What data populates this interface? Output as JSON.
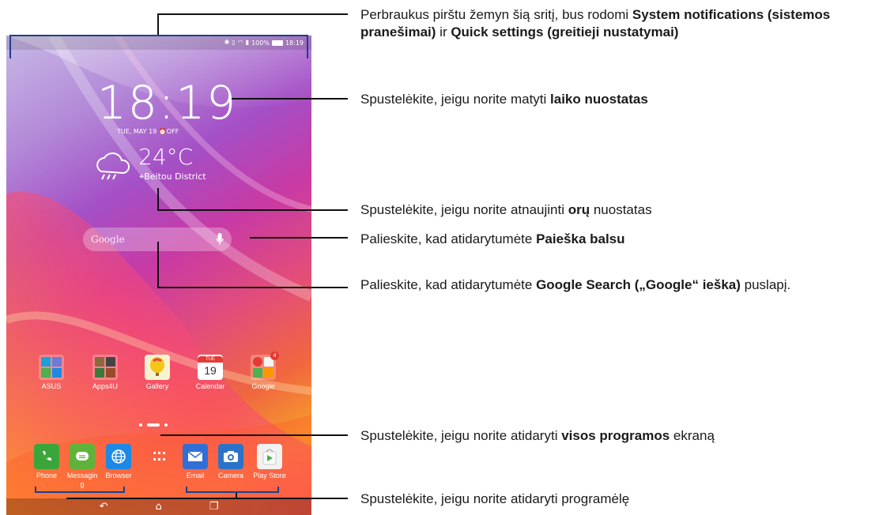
{
  "status_bar": {
    "battery": "100%",
    "time": "18:19"
  },
  "clock": {
    "time": "18:19",
    "date": "TUE, MAY 19",
    "alarm": "OFF"
  },
  "weather": {
    "temperature": "24°C",
    "location": "Beitou District"
  },
  "search": {
    "label": "Google"
  },
  "home_apps": [
    {
      "label": "ASUS"
    },
    {
      "label": "Apps4U"
    },
    {
      "label": "Gallery"
    },
    {
      "label": "Calendar",
      "day": "19",
      "weekday": "TUE"
    },
    {
      "label": "Google",
      "badge": "4"
    }
  ],
  "dock_apps": [
    {
      "label": "Phone"
    },
    {
      "label": "Messagin\ng"
    },
    {
      "label": "Browser"
    },
    {
      "label": "Email"
    },
    {
      "label": "Camera"
    },
    {
      "label": "Play Store"
    }
  ],
  "annotations": {
    "a1_pre": "Perbraukus pirštu žemyn šią sritį, bus rodomi ",
    "a1_b1": "System notifications (sistemos pranešimai)",
    "a1_mid": " ir ",
    "a1_b2": "Quick settings (greitieji nustatymai)",
    "a2_pre": "Spustelėkite, jeigu norite matyti ",
    "a2_b": "laiko nuostatas",
    "a3_pre": "Spustelėkite, jeigu norite atnaujinti ",
    "a3_b": "orų",
    "a3_post": " nuostatas",
    "a4_pre": "Palieskite, kad atidarytumėte ",
    "a4_b": "Paieška balsu",
    "a5_pre": "Palieskite, kad atidarytumėte ",
    "a5_b": "Google Search („Google“ ieška)",
    "a5_post": " puslapį.",
    "a6_pre": "Spustelėkite, jeigu norite atidaryti ",
    "a6_b": "visos programos",
    "a6_post": " ekraną",
    "a7": "Spustelėkite, jeigu norite atidaryti programėlę"
  },
  "colors": {
    "bracket": "#1e3f8c",
    "phone": "#3aa63a",
    "messaging": "#5fb33a",
    "browser": "#1e88e5",
    "email": "#2f6fd6",
    "camera": "#2b73c9"
  }
}
